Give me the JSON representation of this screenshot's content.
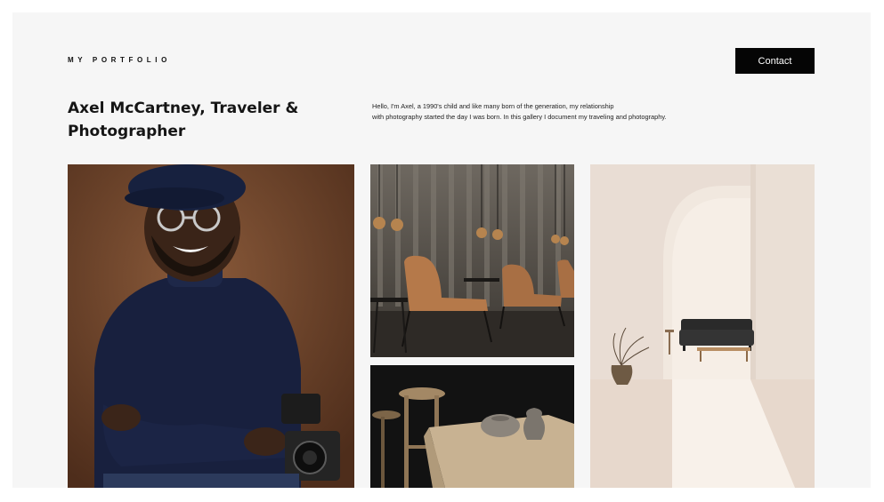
{
  "header": {
    "brand": "MY PORTFOLIO",
    "contact_label": "Contact"
  },
  "hero": {
    "title_line1": "Axel McCartney, Traveler &",
    "title_line2": "Photographer",
    "intro_line1": "Hello, I'm Axel, a 1990's child and like many born of the generation, my relationship",
    "intro_line2": "with photography started the day I was born. In this gallery I document my traveling and photography."
  },
  "gallery": {
    "photos": [
      {
        "subject": "portrait-photo"
      },
      {
        "subject": "lounge-chairs-photo"
      },
      {
        "subject": "stool-and-vases-photo"
      },
      {
        "subject": "archway-interior-photo"
      }
    ]
  },
  "colors": {
    "page_bg": "#ffffff",
    "card_bg": "#f6f6f6",
    "button_bg": "#050505",
    "button_text": "#ffffff",
    "text": "#151515"
  }
}
